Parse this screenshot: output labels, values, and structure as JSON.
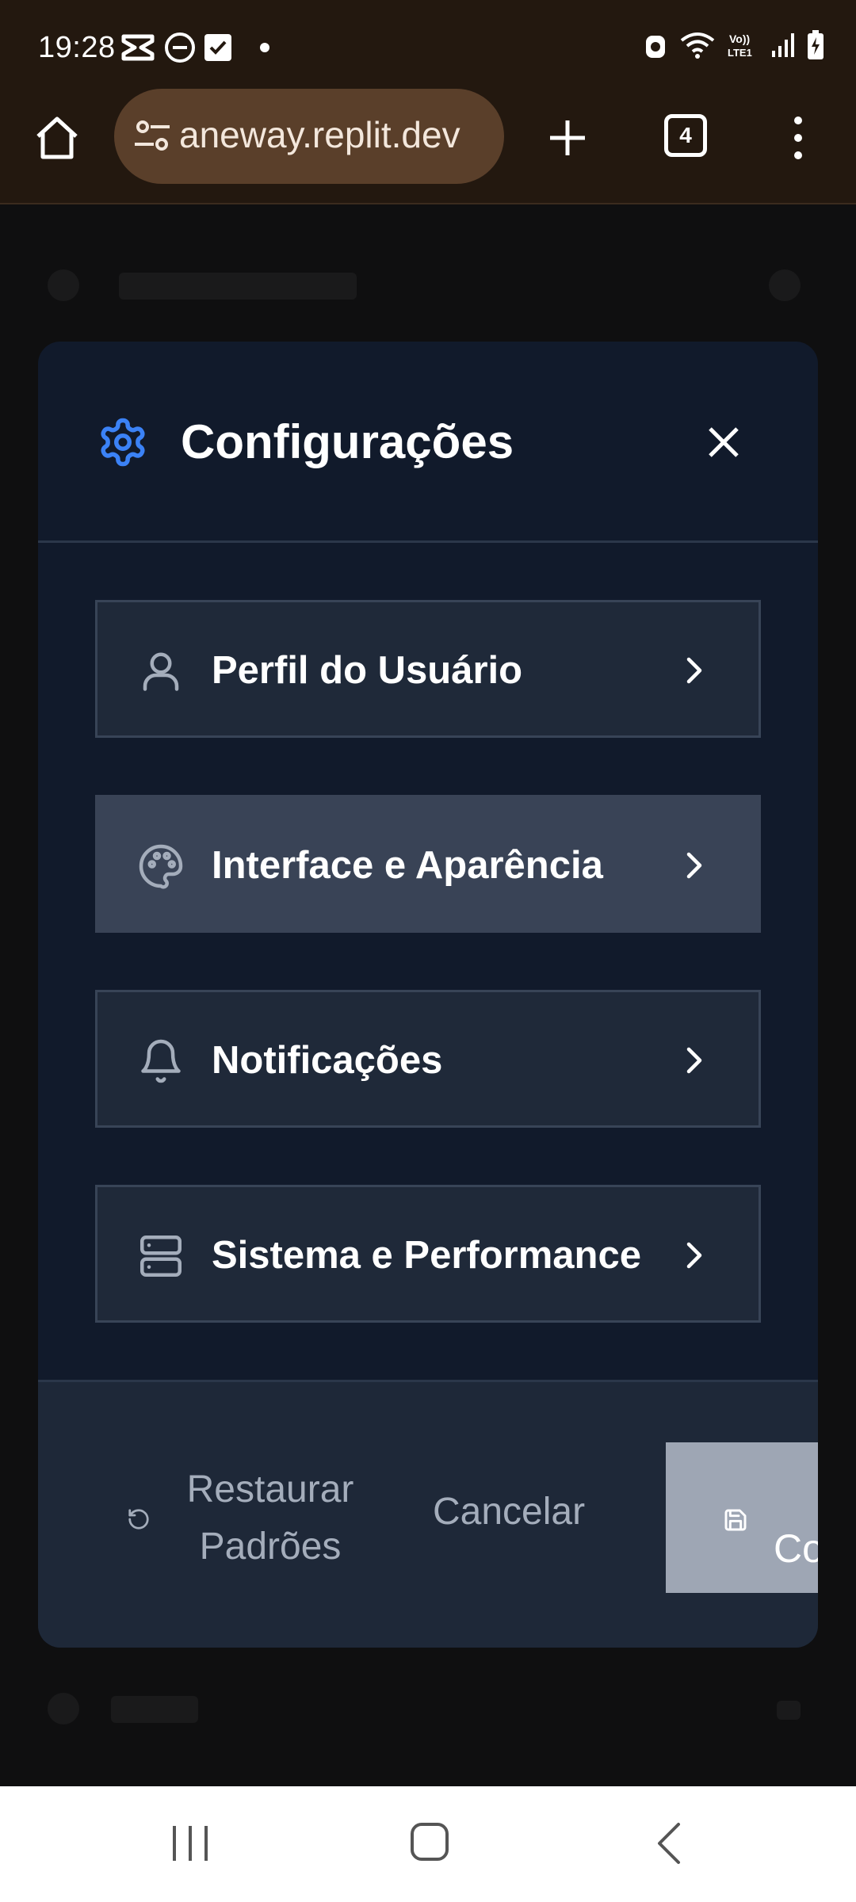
{
  "status_bar": {
    "time": "19:28"
  },
  "browser": {
    "url": "aneway.replit.dev",
    "tab_count": "4"
  },
  "modal": {
    "title": "Configurações",
    "items": [
      {
        "label": "Perfil do Usuário",
        "icon": "user-icon",
        "active": false
      },
      {
        "label": "Interface e Aparência",
        "icon": "palette-icon",
        "active": true
      },
      {
        "label": "Notificações",
        "icon": "bell-icon",
        "active": false
      },
      {
        "label": "Sistema e Performance",
        "icon": "server-icon",
        "active": false
      }
    ],
    "footer": {
      "restore_line1": "Restaurar",
      "restore_line2": "Padrões",
      "cancel": "Cancelar",
      "save": "Co"
    }
  },
  "colors": {
    "accent": "#3b82f6",
    "modal_bg": "#111a2b",
    "item_bg": "#1f2939",
    "item_active_bg": "#394356",
    "save_bg": "#9ea6b4",
    "browser_bar": "#23180f"
  }
}
